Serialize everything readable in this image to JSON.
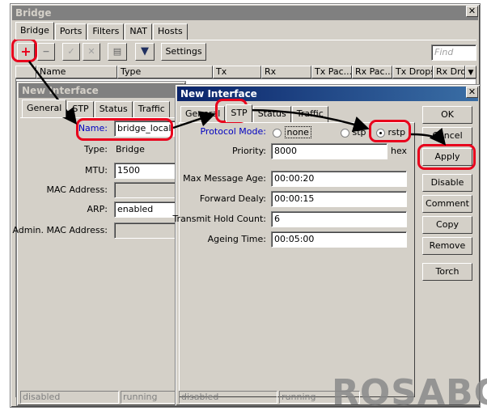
{
  "bridge_window": {
    "title": "Bridge",
    "tabs": [
      "Bridge",
      "Ports",
      "Filters",
      "NAT",
      "Hosts"
    ],
    "settings_label": "Settings",
    "find_placeholder": "Find",
    "columns": [
      "Name",
      "Type",
      "Tx",
      "Rx",
      "Tx Pac...",
      "Rx Pac...",
      "Tx Drops",
      "Rx Drop"
    ]
  },
  "iface_back": {
    "title": "New Interface",
    "tabs": [
      "General",
      "STP",
      "Status",
      "Traffic"
    ],
    "fields": [
      {
        "label": "Name:",
        "value": "bridge_local"
      },
      {
        "label": "Type:",
        "value": "Bridge"
      },
      {
        "label": "MTU:",
        "value": "1500"
      },
      {
        "label": "MAC Address:",
        "value": ""
      },
      {
        "label": "ARP:",
        "value": "enabled"
      },
      {
        "label": "Admin. MAC Address:",
        "value": ""
      }
    ],
    "status": [
      "disabled",
      "running"
    ]
  },
  "iface_front": {
    "title": "New Interface",
    "tabs": [
      "General",
      "STP",
      "Status",
      "Traffic"
    ],
    "protocol_mode_label": "Protocol Mode:",
    "protocol_options": [
      "none",
      "stp",
      "rstp"
    ],
    "protocol_selected": "rstp",
    "priority_label": "Priority:",
    "priority_value": "8000",
    "priority_unit": "hex",
    "fields": [
      {
        "label": "Max Message Age:",
        "value": "00:00:20"
      },
      {
        "label": "Forward Dealy:",
        "value": "00:00:15"
      },
      {
        "label": "Transmit Hold Count:",
        "value": "6"
      },
      {
        "label": "Ageing Time:",
        "value": "00:05:00"
      }
    ],
    "buttons": [
      "OK",
      "Cancel",
      "Apply",
      "Disable",
      "Comment",
      "Copy",
      "Remove",
      "Torch"
    ],
    "status": [
      "disabled",
      "running"
    ]
  },
  "watermark": "ROSABC",
  "annotation_color": "#e8001c"
}
